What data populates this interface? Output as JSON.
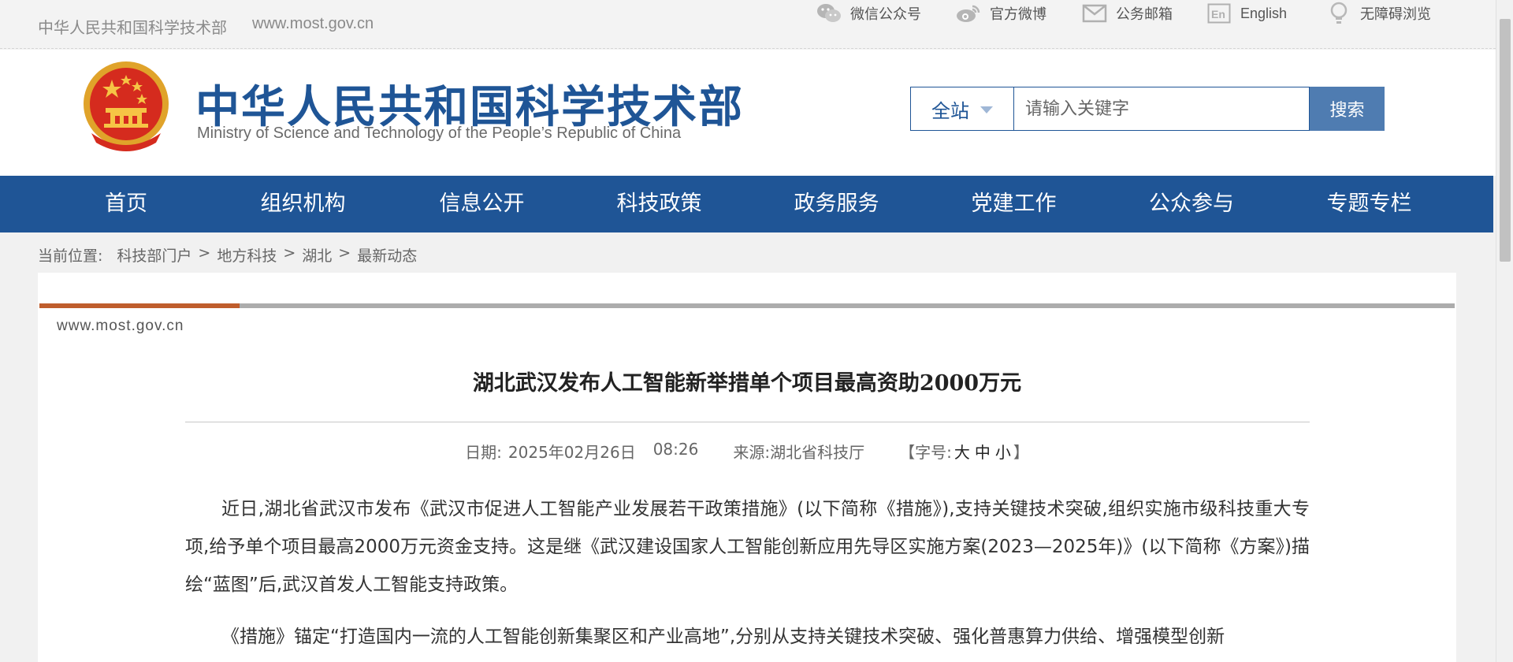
{
  "topbar": {
    "site_name": "中华人民共和国科学技术部",
    "site_url": "www.most.gov.cn",
    "links": [
      {
        "label": "微信公众号",
        "icon": "wechat-icon"
      },
      {
        "label": "官方微博",
        "icon": "weibo-icon"
      },
      {
        "label": "公务邮箱",
        "icon": "mail-icon"
      },
      {
        "label": "English",
        "icon": "english-icon"
      },
      {
        "label": "无障碍浏览",
        "icon": "accessibility-icon"
      }
    ]
  },
  "header": {
    "logo_cn": "中华人民共和国科学技术部",
    "logo_en": "Ministry of Science and Technology of the People’s Republic of China"
  },
  "search": {
    "scope": "全站",
    "placeholder": "请输入关键字",
    "button": "搜索"
  },
  "nav": [
    "首页",
    "组织机构",
    "信息公开",
    "科技政策",
    "政务服务",
    "党建工作",
    "公众参与",
    "专题专栏"
  ],
  "breadcrumb": {
    "label": "当前位置:",
    "items": [
      "科技部门户",
      "地方科技",
      "湖北",
      "最新动态"
    ],
    "separator": ">"
  },
  "article": {
    "watermark": "www.most.gov.cn",
    "title": "湖北武汉发布人工智能新举措单个项目最高资助2000万元",
    "date_label": "日期:",
    "date": "2025年02月26日",
    "time": "08:26",
    "source": "来源:湖北省科技厅",
    "font_label": "【字号:",
    "font_sizes": [
      "大",
      "中",
      "小"
    ],
    "font_close": "】",
    "paragraphs": [
      "近日,湖北省武汉市发布《武汉市促进人工智能产业发展若干政策措施》(以下简称《措施》),支持关键技术突破,组织实施市级科技重大专项,给予单个项目最高2000万元资金支持。这是继《武汉建设国家人工智能创新应用先导区实施方案(2023—2025年)》(以下简称《方案》)描绘“蓝图”后,武汉首发人工智能支持政策。",
      "《措施》锚定“打造国内一流的人工智能创新集聚区和产业高地”,分别从支持关键技术突破、强化普惠算力供给、增强模型创新"
    ]
  },
  "colors": {
    "brand_blue": "#1f5596",
    "search_button": "#4f7cb1",
    "accent_orange": "#bf5d2c"
  }
}
